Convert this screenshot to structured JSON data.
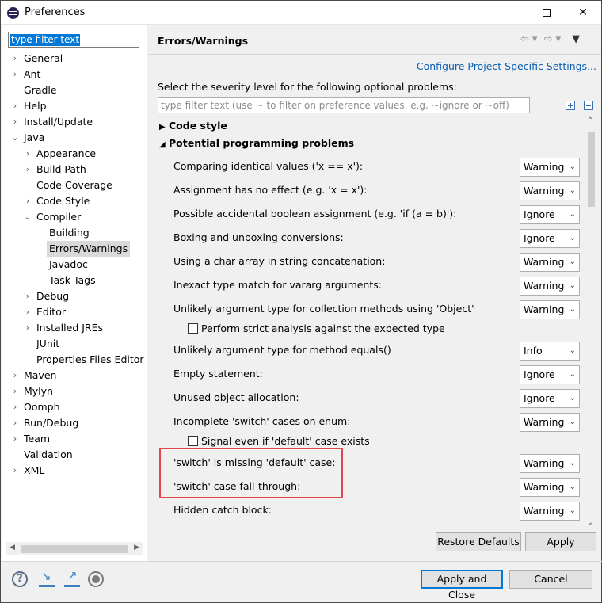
{
  "window": {
    "title": "Preferences"
  },
  "left": {
    "filter_value": "type filter text",
    "tree": [
      {
        "label": "General",
        "expandable": true
      },
      {
        "label": "Ant",
        "expandable": true
      },
      {
        "label": "Gradle",
        "expandable": false
      },
      {
        "label": "Help",
        "expandable": true
      },
      {
        "label": "Install/Update",
        "expandable": true
      },
      {
        "label": "Java",
        "expandable": true,
        "expanded": true
      },
      {
        "label": "Appearance",
        "expandable": true
      },
      {
        "label": "Build Path",
        "expandable": true
      },
      {
        "label": "Code Coverage",
        "expandable": false
      },
      {
        "label": "Code Style",
        "expandable": true
      },
      {
        "label": "Compiler",
        "expandable": true,
        "expanded": true
      },
      {
        "label": "Building",
        "expandable": false
      },
      {
        "label": "Errors/Warnings",
        "expandable": false,
        "selected": true
      },
      {
        "label": "Javadoc",
        "expandable": false
      },
      {
        "label": "Task Tags",
        "expandable": false
      },
      {
        "label": "Debug",
        "expandable": true
      },
      {
        "label": "Editor",
        "expandable": true
      },
      {
        "label": "Installed JREs",
        "expandable": true
      },
      {
        "label": "JUnit",
        "expandable": false
      },
      {
        "label": "Properties Files Editor",
        "expandable": false
      },
      {
        "label": "Maven",
        "expandable": true
      },
      {
        "label": "Mylyn",
        "expandable": true
      },
      {
        "label": "Oomph",
        "expandable": true
      },
      {
        "label": "Run/Debug",
        "expandable": true
      },
      {
        "label": "Team",
        "expandable": true
      },
      {
        "label": "Validation",
        "expandable": false
      },
      {
        "label": "XML",
        "expandable": true
      }
    ]
  },
  "right": {
    "title": "Errors/Warnings",
    "configure_link": "Configure Project Specific Settings...",
    "select_label": "Select the severity level for the following optional problems:",
    "filter_placeholder": "type filter text (use ~ to filter on preference values, e.g. ~ignore or ~off)",
    "sections": {
      "code_style": "Code style",
      "potential": "Potential programming problems"
    },
    "options": [
      {
        "label": "Comparing identical values ('x == x'):",
        "value": "Warning"
      },
      {
        "label": "Assignment has no effect (e.g. 'x = x'):",
        "value": "Warning"
      },
      {
        "label": "Possible accidental boolean assignment (e.g. 'if (a = b)'):",
        "value": "Ignore"
      },
      {
        "label": "Boxing and unboxing conversions:",
        "value": "Ignore"
      },
      {
        "label": "Using a char array in string concatenation:",
        "value": "Warning"
      },
      {
        "label": "Inexact type match for vararg arguments:",
        "value": "Warning"
      },
      {
        "label": "Unlikely argument type for collection methods using 'Object'",
        "value": "Warning"
      },
      {
        "label": "Unlikely argument type for method equals()",
        "value": "Info"
      },
      {
        "label": "Empty statement:",
        "value": "Ignore"
      },
      {
        "label": "Unused object allocation:",
        "value": "Ignore"
      },
      {
        "label": "Incomplete 'switch' cases on enum:",
        "value": "Warning"
      },
      {
        "label": "'switch' is missing 'default' case:",
        "value": "Warning"
      },
      {
        "label": "'switch' case fall-through:",
        "value": "Warning"
      },
      {
        "label": "Hidden catch block:",
        "value": "Warning"
      }
    ],
    "checks": {
      "strict_analysis": {
        "label": "Perform strict analysis against the expected type",
        "checked": false
      },
      "signal_default": {
        "label": "Signal even if 'default' case exists",
        "checked": false
      }
    },
    "buttons": {
      "restore": "Restore Defaults",
      "apply": "Apply"
    }
  },
  "footer": {
    "apply_close": "Apply and Close",
    "cancel": "Cancel"
  },
  "colors": {
    "highlight": "#e0484b",
    "link": "#0a5fb4",
    "selection": "#0078d7"
  }
}
